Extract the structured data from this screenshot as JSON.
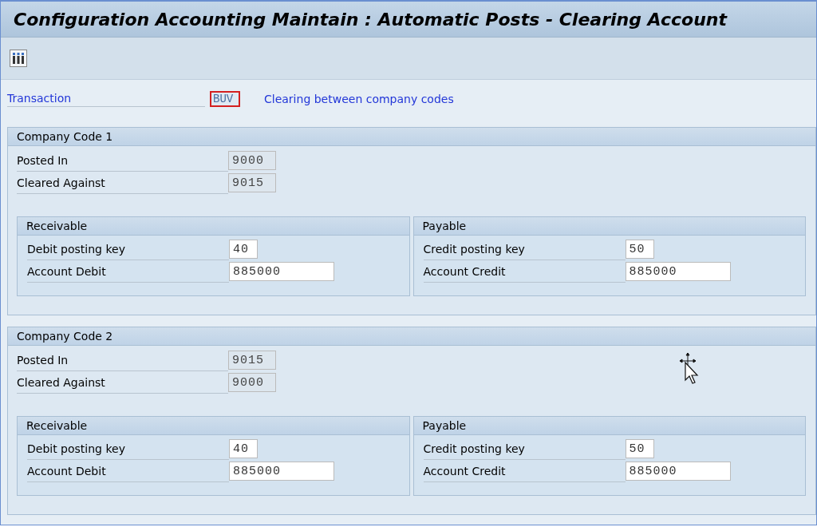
{
  "window": {
    "title": "Configuration Accounting Maintain : Automatic Posts - Clearing Account"
  },
  "transaction": {
    "label": "Transaction",
    "value": "BUV",
    "focused": true,
    "description": "Clearing between company codes"
  },
  "groups": [
    {
      "title": "Company Code 1",
      "fields": [
        {
          "label": "Posted In",
          "value": "9000",
          "disabled": true
        },
        {
          "label": "Cleared Against",
          "value": "9015",
          "disabled": true
        }
      ],
      "subgroups": [
        {
          "title": "Receivable",
          "fields": [
            {
              "label": "Debit posting key",
              "value": "40",
              "disabled": false
            },
            {
              "label": "Account Debit",
              "value": "885000",
              "disabled": false
            }
          ]
        },
        {
          "title": "Payable",
          "fields": [
            {
              "label": "Credit posting key",
              "value": "50",
              "disabled": false
            },
            {
              "label": "Account Credit",
              "value": "885000",
              "disabled": false
            }
          ]
        }
      ]
    },
    {
      "title": "Company Code 2",
      "fields": [
        {
          "label": "Posted In",
          "value": "9015",
          "disabled": true
        },
        {
          "label": "Cleared Against",
          "value": "9000",
          "disabled": true
        }
      ],
      "subgroups": [
        {
          "title": "Receivable",
          "fields": [
            {
              "label": "Debit posting key",
              "value": "40",
              "disabled": false
            },
            {
              "label": "Account Debit",
              "value": "885000",
              "disabled": false
            }
          ]
        },
        {
          "title": "Payable",
          "fields": [
            {
              "label": "Credit posting key",
              "value": "50",
              "disabled": false
            },
            {
              "label": "Account Credit",
              "value": "885000",
              "disabled": false
            }
          ]
        }
      ]
    }
  ]
}
